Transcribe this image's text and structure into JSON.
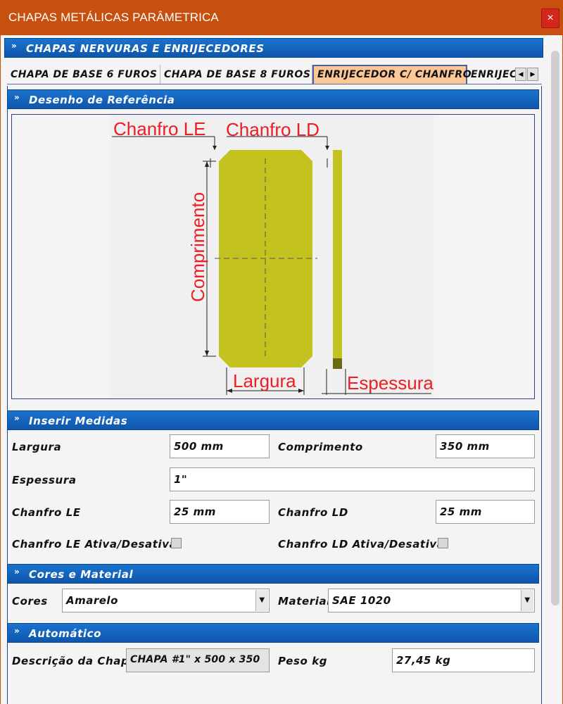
{
  "window": {
    "title": "CHAPAS METÁLICAS PARÂMETRICA",
    "close_label": "×"
  },
  "section_main": {
    "chevron": "»",
    "label": "CHAPAS NERVURAS E ENRIJECEDORES"
  },
  "tabs": [
    {
      "label": "CHAPA DE BASE 6 FUROS"
    },
    {
      "label": "CHAPA DE BASE 8 FUROS"
    },
    {
      "label": "ENRIJECEDOR C/ CHANFRO",
      "active": true
    },
    {
      "label": "ENRIJEC"
    }
  ],
  "tab_scroll": {
    "left": "◀",
    "right": "▶"
  },
  "section_drawing": {
    "chevron": "»",
    "label": "Desenho de Referência"
  },
  "drawing": {
    "chanfro_le": "Chanfro LE",
    "chanfro_ld": "Chanfro LD",
    "comprimento": "Comprimento",
    "largura": "Largura",
    "espessura": "Espessura"
  },
  "section_measures": {
    "chevron": "»",
    "label": "Inserir Medidas"
  },
  "measures": {
    "largura_label": "Largura",
    "largura_value": "500 mm",
    "comprimento_label": "Comprimento",
    "comprimento_value": "350 mm",
    "espessura_label": "Espessura",
    "espessura_value": "1\"",
    "chanfro_le_label": "Chanfro LE",
    "chanfro_le_value": "25 mm",
    "chanfro_ld_label": "Chanfro LD",
    "chanfro_ld_value": "25 mm",
    "chanfro_le_toggle_label": "Chanfro LE Ativa/Desativa",
    "chanfro_ld_toggle_label": "Chanfro LD Ativa/Desativa"
  },
  "section_colors": {
    "chevron": "»",
    "label": "Cores e Material"
  },
  "colors": {
    "cores_label": "Cores",
    "cores_value": "Amarelo",
    "material_label": "Material",
    "material_value": "SAE 1020",
    "dropdown_arrow": "▼"
  },
  "section_auto": {
    "chevron": "»",
    "label": "Automático"
  },
  "auto": {
    "descricao_label": "Descrição da Chapa",
    "descricao_value": "CHAPA #1\" x 500 x 350",
    "peso_label": "Peso kg",
    "peso_value": "27,45 kg"
  },
  "theme": {
    "titlebar": "#c8500f",
    "header_blue": "#1565c0",
    "plate_yellow": "#c3c21f",
    "dimension_red": "#ee1c24",
    "active_tab": "#fbc797"
  }
}
